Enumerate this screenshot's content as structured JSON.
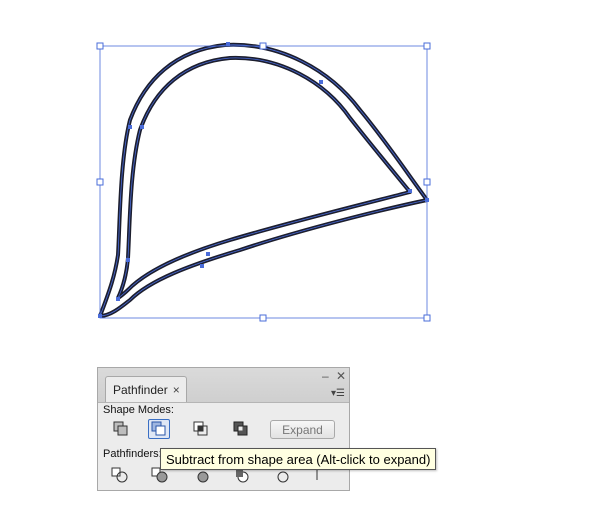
{
  "colors": {
    "selection": "#4a6cd9",
    "stroke": "#1c1e2e",
    "panel_bg": "#ececec",
    "tooltip_bg": "#ffffe1"
  },
  "panel": {
    "tab_label": "Pathfinder",
    "tab_close": "×",
    "minimize": "‒",
    "close": "✕",
    "menu": "▾☰",
    "shape_modes_label": "Shape Modes:",
    "pathfinders_label": "Pathfinders:",
    "expand_label": "Expand",
    "shape_mode_buttons": [
      "unite-icon",
      "minus-front-icon",
      "intersect-icon",
      "exclude-icon"
    ],
    "active_mode": "minus-front-icon",
    "pathfinder_buttons": [
      "divide-icon",
      "trim-icon",
      "merge-icon",
      "crop-icon",
      "outline-icon",
      "minus-back-icon"
    ]
  },
  "tooltip": {
    "text": "Subtract from shape area (Alt-click to expand)"
  }
}
